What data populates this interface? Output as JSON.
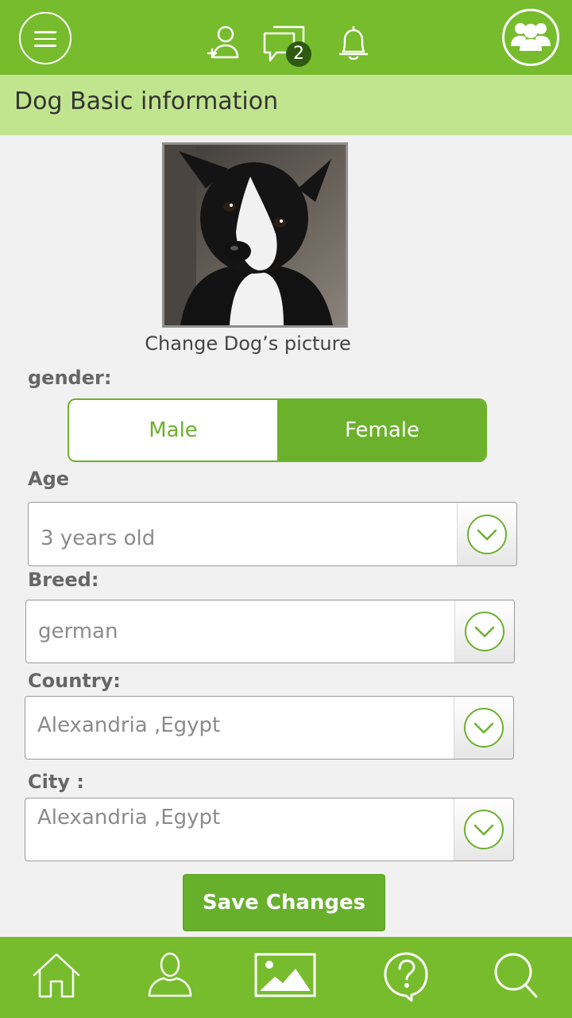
{
  "header": {
    "menu_icon": "hamburger-menu-icon",
    "add_friend_icon": "add-user-icon",
    "messages_icon": "chat-bubbles-icon",
    "messages_badge": "2",
    "notifications_icon": "bell-icon",
    "group_icon": "group-users-icon"
  },
  "page": {
    "title": "Dog Basic information"
  },
  "photo": {
    "change_label": "Change Dog’s picture"
  },
  "gender": {
    "label": "gender:",
    "options": [
      "Male",
      "Female"
    ],
    "selected": "Female"
  },
  "age": {
    "label": "Age",
    "value": "3 years old"
  },
  "breed": {
    "label": "Breed:",
    "value": "german"
  },
  "country": {
    "label": "Country:",
    "value": "Alexandria ,Egypt"
  },
  "city": {
    "label": "City :",
    "value": "Alexandria ,Egypt"
  },
  "actions": {
    "save_label": "Save Changes"
  },
  "bottom_nav": {
    "items": [
      "home-icon",
      "profile-icon",
      "gallery-icon",
      "help-icon",
      "search-icon"
    ]
  },
  "colors": {
    "brand_green": "#76bc2c",
    "light_green": "#c1e58f",
    "button_green": "#67b02c",
    "background": "#f1f1f1"
  }
}
